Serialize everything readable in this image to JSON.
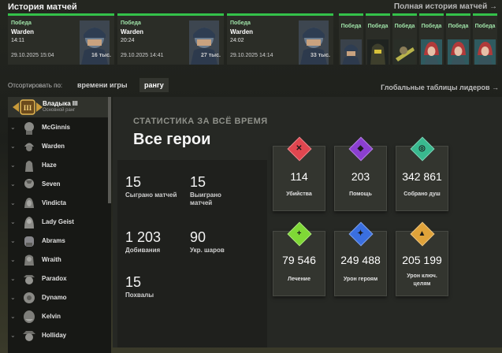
{
  "header": {
    "title": "История матчей",
    "full_history_link": "Полная история матчей →"
  },
  "matches": [
    {
      "result": "Победа",
      "hero": "Warden",
      "duration": "14:11",
      "date": "29.10.2025 15:04",
      "souls": "16 тыс.",
      "portrait": "warden-portrait"
    },
    {
      "result": "Победа",
      "hero": "Warden",
      "duration": "20:24",
      "date": "29.10.2025 14:41",
      "souls": "27 тыс.",
      "portrait": "warden-portrait"
    },
    {
      "result": "Победа",
      "hero": "Warden",
      "duration": "24:02",
      "date": "29.10.2025 14:14",
      "souls": "33 тыс.",
      "portrait": "warden-portrait"
    }
  ],
  "mini_matches": [
    {
      "result": "Победа",
      "portrait": "warden-portrait"
    },
    {
      "result": "Победа",
      "portrait": "hooded-hero-portrait"
    },
    {
      "result": "Победа",
      "portrait": "gunner-hero-portrait"
    },
    {
      "result": "Победа",
      "portrait": "redhair-hero-portrait"
    },
    {
      "result": "Победа",
      "portrait": "redhair-hero-portrait"
    },
    {
      "result": "Победа",
      "portrait": "redhair-hero-portrait"
    }
  ],
  "sort": {
    "label": "Отсортировать по:",
    "options": [
      "времени игры",
      "рангу"
    ],
    "active": "рангу"
  },
  "leaderboards_link": "Глобальные таблицы лидеров →",
  "sidebar": {
    "rank_name": "Владыка III",
    "rank_sub": "Основной ранг",
    "heroes": [
      "McGinnis",
      "Warden",
      "Haze",
      "Seven",
      "Vindicta",
      "Lady Geist",
      "Abrams",
      "Wraith",
      "Paradox",
      "Dynamo",
      "Kelvin",
      "Holliday"
    ]
  },
  "stats": {
    "section_title": "СТАТИСТИКА ЗА ВСЁ ВРЕМЯ",
    "heading": "Все герои",
    "left": [
      {
        "value": "15",
        "label": "Сыграно матчей"
      },
      {
        "value": "15",
        "label": "Выиграно матчей"
      },
      {
        "value": "1 203",
        "label": "Добивания"
      },
      {
        "value": "90",
        "label": "Укр. шаров"
      },
      {
        "value": "15",
        "label": "Похвалы"
      }
    ],
    "boxes": [
      {
        "value": "114",
        "label": "Убийства",
        "color": "#e0464f",
        "icon": "skull-icon"
      },
      {
        "value": "203",
        "label": "Помощь",
        "color": "#8b3fd0",
        "icon": "handshake-icon"
      },
      {
        "value": "342 861",
        "label": "Собрано душ",
        "color": "#39b98f",
        "icon": "soul-icon"
      },
      {
        "value": "79 546",
        "label": "Лечение",
        "color": "#7fd836",
        "icon": "plus-icon"
      },
      {
        "value": "249 488",
        "label": "Урон героям",
        "color": "#3a6fe0",
        "icon": "hero-damage-icon"
      },
      {
        "value": "205 199",
        "label": "Урон ключ. целям",
        "color": "#e0a33a",
        "icon": "objective-damage-icon"
      }
    ]
  },
  "colors": {
    "win_accent": "#34c24a",
    "panel": "#262824"
  }
}
